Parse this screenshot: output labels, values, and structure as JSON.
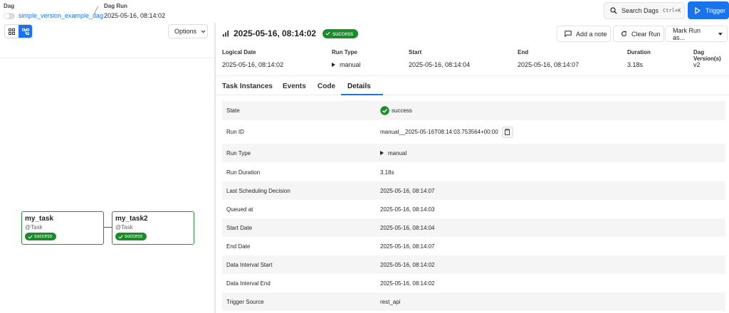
{
  "breadcrumb": {
    "dag_label": "Dag",
    "dag_name": "simple_version_example_dag",
    "run_label": "Dag Run",
    "run_value": "2025-05-16, 08:14:02"
  },
  "header": {
    "search_label": "Search Dags",
    "search_shortcut": "Ctrl+K",
    "trigger_label": "Trigger"
  },
  "graph": {
    "options_label": "Options",
    "nodes": [
      {
        "name": "my_task",
        "decorator": "@Task",
        "state": "success"
      },
      {
        "name": "my_task2",
        "decorator": "@Task",
        "state": "success"
      }
    ]
  },
  "run": {
    "title": "2025-05-16, 08:14:02",
    "state": "success",
    "actions": {
      "add_note": "Add a note",
      "clear_run": "Clear Run",
      "mark_run": "Mark Run as..."
    }
  },
  "summary": {
    "headers": [
      "Logical Date",
      "Run Type",
      "Start",
      "End",
      "Duration",
      "Dag Version(s)"
    ],
    "values": [
      "2025-05-16, 08:14:02",
      "manual",
      "2025-05-16, 08:14:04",
      "2025-05-16, 08:14:07",
      "3.18s",
      "v2"
    ]
  },
  "tabs": [
    "Task Instances",
    "Events",
    "Code",
    "Details"
  ],
  "active_tab": "Details",
  "details": [
    {
      "key": "State",
      "value": "success"
    },
    {
      "key": "Run ID",
      "value": "manual__2025-05-16T08:14:03.753564+00:00"
    },
    {
      "key": "Run Type",
      "value": "manual"
    },
    {
      "key": "Run Duration",
      "value": "3.18s"
    },
    {
      "key": "Last Scheduling Decision",
      "value": "2025-05-16, 08:14:07"
    },
    {
      "key": "Queued at",
      "value": "2025-05-16, 08:14:03"
    },
    {
      "key": "Start Date",
      "value": "2025-05-16, 08:14:04"
    },
    {
      "key": "End Date",
      "value": "2025-05-16, 08:14:07"
    },
    {
      "key": "Data Interval Start",
      "value": "2025-05-16, 08:14:02"
    },
    {
      "key": "Data Interval End",
      "value": "2025-05-16, 08:14:02"
    },
    {
      "key": "Trigger Source",
      "value": "rest_api"
    }
  ],
  "colors": {
    "accent": "#1a73e8",
    "success": "#1c8c2b",
    "node_border": "#2e8b3a"
  }
}
